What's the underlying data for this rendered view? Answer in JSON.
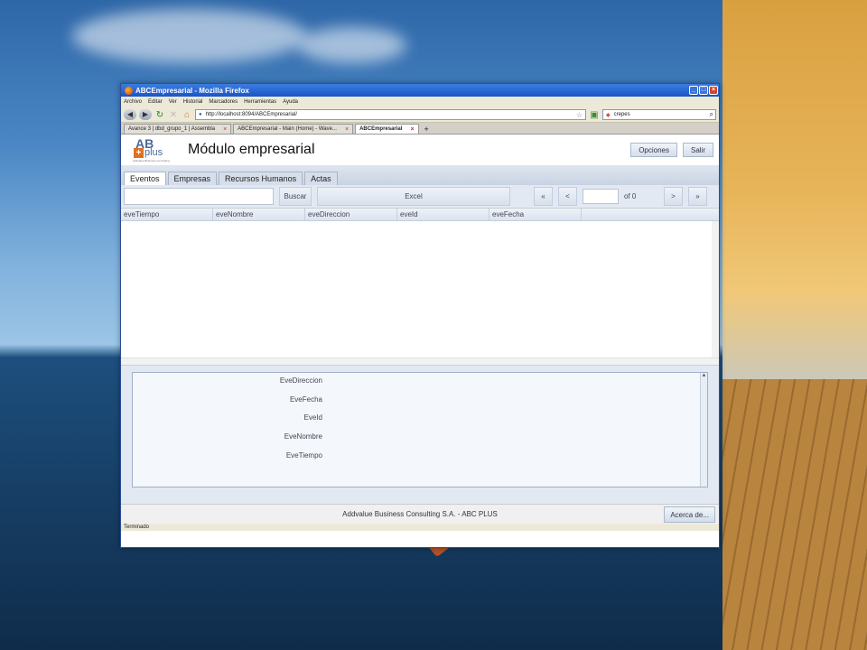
{
  "browser": {
    "window_title": "ABCEmpresarial - Mozilla Firefox",
    "menu": [
      "Archivo",
      "Editar",
      "Ver",
      "Historial",
      "Marcadores",
      "Herramientas",
      "Ayuda"
    ],
    "url": "http://localhost:8094/ABCEmpresarial/",
    "search_value": "crepes",
    "tabs": [
      {
        "label": "Avance 3 | dbd_grupo_1 | Assembla"
      },
      {
        "label": "ABCEmpresarial - Main (Home) - Wave..."
      },
      {
        "label": "ABCEmpresarial"
      }
    ],
    "status": "Terminado"
  },
  "app": {
    "logo": {
      "ab": "AB",
      "plus_sign": "+",
      "plus_text": "plus",
      "tagline": "Addvalue Business Consulting"
    },
    "title": "Módulo empresarial",
    "options_label": "Opciones",
    "exit_label": "Salir",
    "tabs": [
      "Eventos",
      "Empresas",
      "Recursos Humanos",
      "Actas"
    ],
    "toolbar": {
      "search_label": "Buscar",
      "excel_label": "Excel",
      "first": "«",
      "prev": "<",
      "of_text": "of 0",
      "next": ">",
      "last": "»"
    },
    "columns": [
      "eveTiempo",
      "eveNombre",
      "eveDireccion",
      "eveId",
      "eveFecha"
    ],
    "detail_fields": [
      "EveDireccion",
      "EveFecha",
      "EveId",
      "EveNombre",
      "EveTiempo"
    ],
    "footer": "Addvalue Business Consulting S.A. - ABC PLUS",
    "about_label": "Acerca de..."
  },
  "colors": {
    "titlebar": "#1a55c7",
    "app_panel": "#e3e9f2",
    "logo_orange": "#e07020"
  }
}
